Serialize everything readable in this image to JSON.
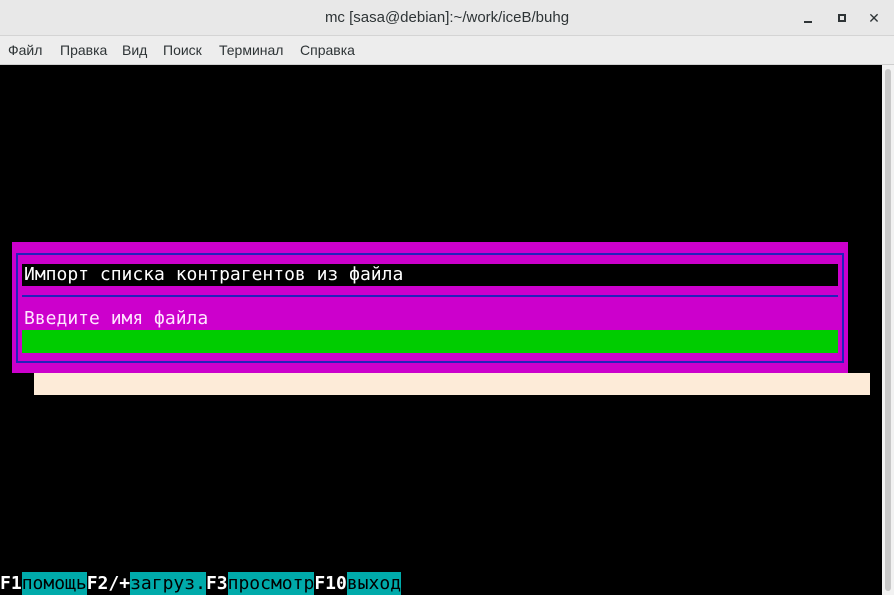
{
  "window": {
    "title": "mc [sasa@debian]:~/work/iceB/buhg",
    "controls": {
      "minimize": "minimize-icon",
      "maximize": "maximize-icon",
      "close": "close-icon"
    }
  },
  "menu": [
    "Файл",
    "Правка",
    "Вид",
    "Поиск",
    "Терминал",
    "Справка"
  ],
  "dialog": {
    "title": "Импорт списка контрагентов из файла",
    "prompt": "Введите имя файла",
    "input_value": ""
  },
  "fkeys": [
    {
      "key": "F1",
      "label": "помощь"
    },
    {
      "key": "F2/+",
      "label": "загруз."
    },
    {
      "key": "F3",
      "label": "просмотр"
    },
    {
      "key": "F10",
      "label": "выход"
    }
  ],
  "colors": {
    "dialog_bg": "#cc00cc",
    "dialog_frame": "#2222bb",
    "input_bg": "#00cc00",
    "shadow": "#fdebd8",
    "fkey_label_bg": "#00aaaa"
  }
}
